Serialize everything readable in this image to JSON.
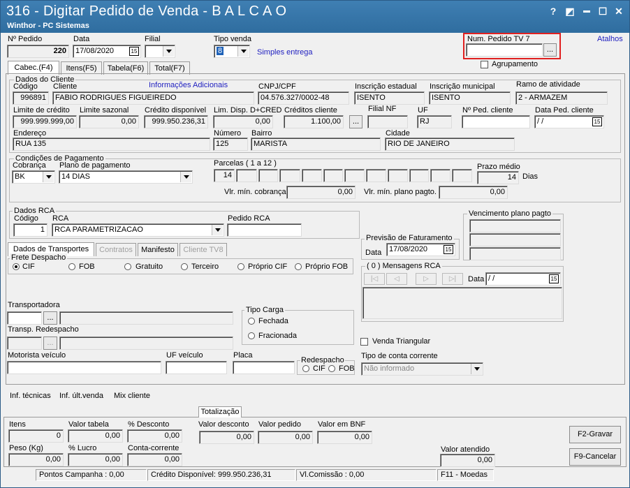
{
  "window": {
    "title": "316 - Digitar Pedido de Venda - B A L C A O",
    "subtitle": "Winthor - PC Sistemas",
    "help": "?",
    "restore": "◩",
    "minimize": "▬",
    "maximize": "☐",
    "close": "✕"
  },
  "header": {
    "num_pedido_label": "Nº Pedido",
    "num_pedido": "220",
    "data_label": "Data",
    "data": "17/08/2020",
    "filial_label": "Filial",
    "filial": "",
    "tipo_venda_label": "Tipo venda",
    "tipo_venda": "8",
    "tipo_venda_desc": "Simples entrega",
    "num_tv7_label": "Num. Pedido TV 7",
    "num_tv7": "",
    "ellipsis": "...",
    "atalhos": "Atalhos",
    "agrupamento": "Agrupamento",
    "cal_icon": "15"
  },
  "tabs": [
    "Cabec.(F4)",
    "Itens(F5)",
    "Tabela(F6)",
    "Total(F7)"
  ],
  "cliente": {
    "group": "Dados do Cliente",
    "codigo_label": "Código",
    "codigo": "996891",
    "cliente_label": "Cliente",
    "cliente": "FABIO RODRIGUES FIGUEIREDO",
    "info": "Informações Adicionais",
    "cnpj_label": "CNPJ/CPF",
    "cnpj": "04.576.327/0002-48",
    "ie_label": "Inscrição estadual",
    "ie": "ISENTO",
    "im_label": "Inscrição municipal",
    "im": "ISENTO",
    "ramo_label": "Ramo de atividade",
    "ramo": "2 - ARMAZEM",
    "limite_label": "Limite de crédito",
    "limite": "999.999.999,00",
    "sazonal_label": "Limite sazonal",
    "sazonal": "0,00",
    "credito_label": "Crédito disponível",
    "credito": "999.950.236,31",
    "lim_disp_label": "Lim. Disp. D+CRED",
    "lim_disp": "0,00",
    "creditos_label": "Créditos cliente",
    "creditos": "1.100,00",
    "filial_nf_label": "Filial NF",
    "filial_nf": "",
    "uf_label": "UF",
    "uf": "RJ",
    "ped_cliente_label": "Nº Ped. cliente",
    "ped_cliente": "",
    "data_ped_label": "Data Ped. cliente",
    "data_ped": "/ /",
    "endereco_label": "Endereço",
    "endereco": "RUA 135",
    "numero_label": "Número",
    "numero": "125",
    "bairro_label": "Bairro",
    "bairro": "MARISTA",
    "cidade_label": "Cidade",
    "cidade": "RIO DE JANEIRO"
  },
  "pagamento": {
    "group": "Condições de Pagamento",
    "cobranca_label": "Cobrança",
    "cobranca": "BK",
    "plano_label": "Plano de pagamento",
    "plano": "14 DIAS",
    "parcelas_label": "Parcelas ( 1 a 12 )",
    "parcela1": "14",
    "prazo_label": "Prazo médio",
    "prazo": "14",
    "dias": "Dias",
    "vlr_min_cob_label": "Vlr. mín. cobrança",
    "vlr_min_cob": "0,00",
    "vlr_min_plano_label": "Vlr. mín. plano pagto.",
    "vlr_min_plano": "0,00"
  },
  "rca": {
    "group": "Dados RCA",
    "codigo_label": "Código",
    "codigo": "1",
    "rca_label": "RCA",
    "rca": "RCA PARAMETRIZACAO",
    "pedido_label": "Pedido RCA",
    "pedido": ""
  },
  "vencimento": {
    "label": "Vencimento plano pagto"
  },
  "previsao": {
    "group": "Previsão de Faturamento",
    "data_label": "Data",
    "data": "17/08/2020"
  },
  "mensagens": {
    "group": "( 0 ) Mensagens RCA",
    "data_label": "Data",
    "data": "/ /"
  },
  "transp_tabs": [
    "Dados de Transportes",
    "Contratos",
    "Manifesto",
    "Cliente TV8"
  ],
  "frete": {
    "group": "Frete Despacho",
    "options": [
      "CIF",
      "FOB",
      "Gratuito",
      "Terceiro",
      "Próprio CIF",
      "Próprio FOB"
    ]
  },
  "transporte": {
    "transportadora_label": "Transportadora",
    "redespacho_label": "Transp. Redespacho",
    "tipo_carga_label": "Tipo Carga",
    "fechada": "Fechada",
    "fracionada": "Fracionada",
    "motorista_label": "Motorista veículo",
    "uf_veiculo_label": "UF veículo",
    "placa_label": "Placa",
    "redespacho_group": "Redespacho",
    "cif": "CIF",
    "fob": "FOB",
    "triangular": "Venda Triangular",
    "tipo_conta_label": "Tipo de conta corrente",
    "tipo_conta": "Não informado"
  },
  "links": [
    "Inf. técnicas",
    "Inf. últ.venda",
    "Mix cliente"
  ],
  "totalizacao": {
    "tab": "Totalização",
    "itens_label": "Itens",
    "itens": "0",
    "valor_tabela_label": "Valor tabela",
    "valor_tabela": "0,00",
    "pct_desc_label": "% Desconto",
    "pct_desc": "0,00",
    "valor_desc_label": "Valor desconto",
    "valor_desc": "0,00",
    "valor_pedido_label": "Valor pedido",
    "valor_pedido": "0,00",
    "valor_bnf_label": "Valor em BNF",
    "valor_bnf": "0,00",
    "peso_label": "Peso (Kg)",
    "peso": "0,00",
    "pct_lucro_label": "% Lucro",
    "pct_lucro": "0,00",
    "conta_label": "Conta-corrente",
    "conta": "0,00",
    "valor_atendido_label": "Valor atendido",
    "valor_atendido": "0,00",
    "gravar": "F2-Gravar",
    "cancelar": "F9-Cancelar"
  },
  "statusbar": {
    "pontos": "Pontos Campanha : 0,00",
    "credito": "Crédito Disponível: 999.950.236,31",
    "comissao": "Vl.Comissão : 0,00",
    "moedas": "F11 - Moedas"
  }
}
